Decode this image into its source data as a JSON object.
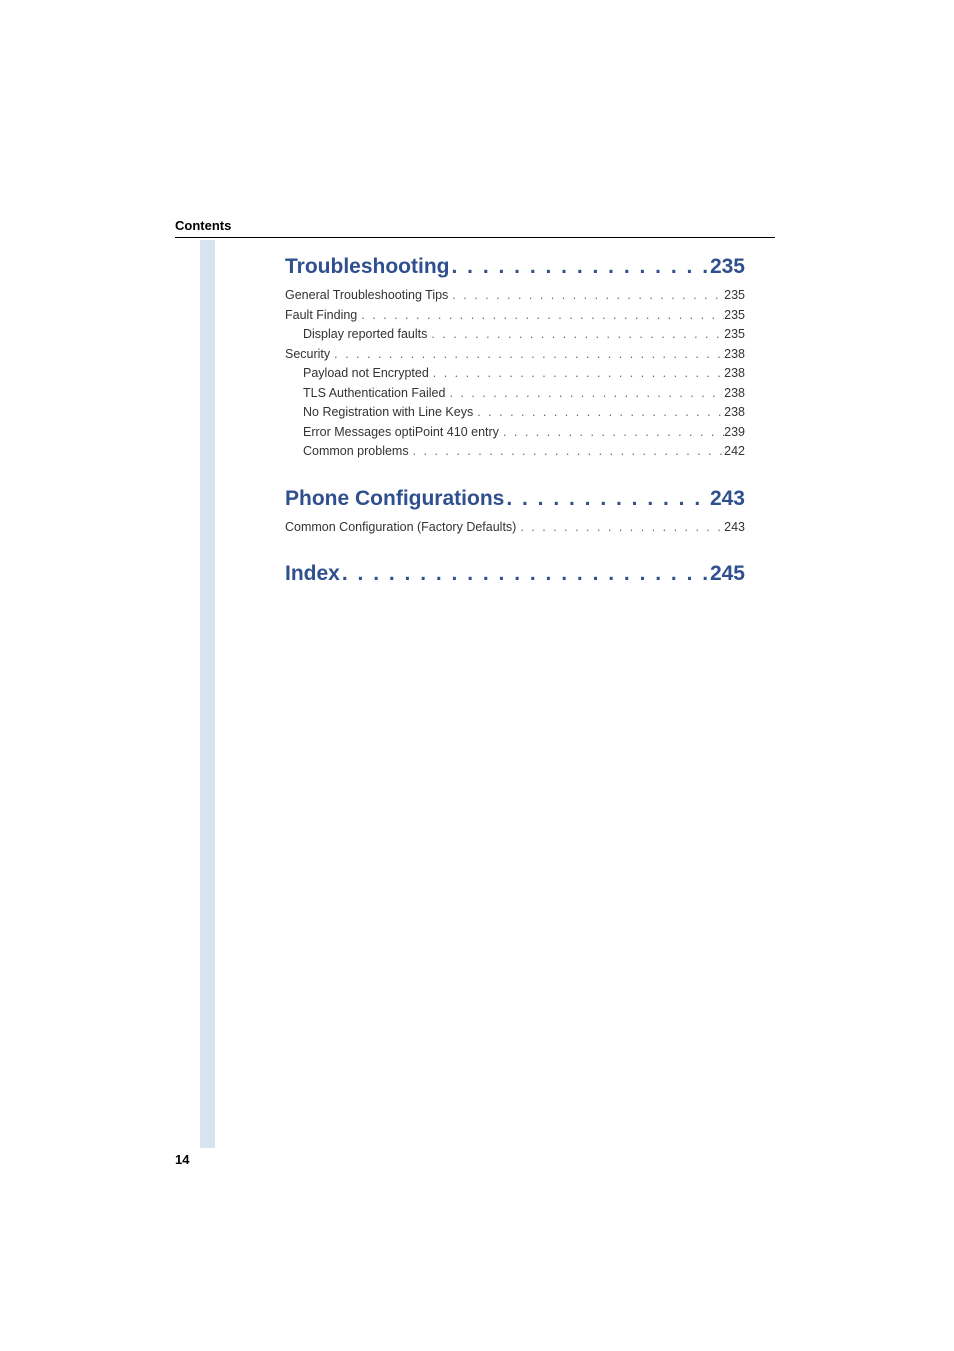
{
  "section_label": "Contents",
  "page_number": "14",
  "leader_heading": ". . . . . . . . . . . . . . . . . . . . . . . . . . . . . . . . . . . . . . . . . . . . . . . . . .",
  "leader_entry": ". . . . . . . . . . . . . . . . . . . . . . . . . . . . . . . . . . . . . . . . . . . . . . . . . . . . . . . . . . . . . . . . . . . . . . . . . . . . . . . .",
  "sections": [
    {
      "title": "Troubleshooting",
      "page": "235",
      "entries": [
        {
          "indent": 0,
          "title": "General Troubleshooting Tips",
          "page": "235"
        },
        {
          "indent": 0,
          "title": "Fault Finding",
          "page": "235"
        },
        {
          "indent": 1,
          "title": "Display reported faults",
          "page": "235"
        },
        {
          "indent": 0,
          "title": "Security",
          "page": "238"
        },
        {
          "indent": 1,
          "title": "Payload not Encrypted",
          "page": "238"
        },
        {
          "indent": 1,
          "title": "TLS Authentication Failed",
          "page": "238"
        },
        {
          "indent": 1,
          "title": "No Registration with Line Keys",
          "page": "238"
        },
        {
          "indent": 1,
          "title": "Error Messages optiPoint 410 entry",
          "page": "239"
        },
        {
          "indent": 1,
          "title": "Common problems",
          "page": "242"
        }
      ]
    },
    {
      "title": "Phone Configurations",
      "page": "243",
      "entries": [
        {
          "indent": 0,
          "title": "Common Configuration (Factory Defaults)",
          "page": "243"
        }
      ]
    },
    {
      "title": "Index",
      "page": "245",
      "entries": []
    }
  ]
}
